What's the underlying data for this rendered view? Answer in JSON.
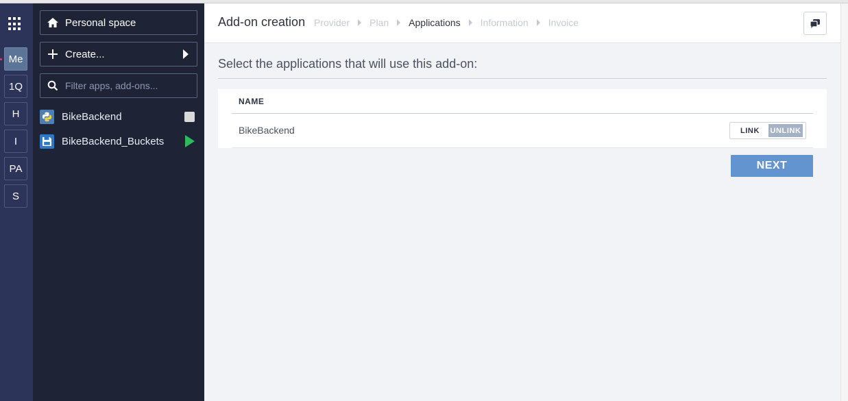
{
  "rail": {
    "orgs": [
      {
        "label": "Me",
        "active": true
      },
      {
        "label": "1Q",
        "active": false
      },
      {
        "label": "H",
        "active": false
      },
      {
        "label": "I",
        "active": false
      },
      {
        "label": "PA",
        "active": false
      },
      {
        "label": "S",
        "active": false
      }
    ]
  },
  "sidebar": {
    "personal_space_label": "Personal space",
    "create_label": "Create...",
    "filter_placeholder": "Filter apps, add-ons...",
    "apps": [
      {
        "name": "BikeBackend",
        "icon": "python-icon",
        "status": "stopped"
      },
      {
        "name": "BikeBackend_Buckets",
        "icon": "floppy-disk-icon",
        "status": "running"
      }
    ]
  },
  "header": {
    "title": "Add-on creation",
    "steps": [
      "Provider",
      "Plan",
      "Applications",
      "Information",
      "Invoice"
    ],
    "current_step": "Applications"
  },
  "main": {
    "subtitle": "Select the applications that will use this add-on:",
    "table": {
      "column_name": "NAME",
      "rows": [
        {
          "name": "BikeBackend",
          "link_label": "LINK",
          "unlink_label": "UNLINK",
          "selected": "UNLINK"
        }
      ]
    },
    "next_label": "NEXT"
  },
  "colors": {
    "rail_bg": "#2c3459",
    "sidebar_bg": "#1e2436",
    "accent": "#6394cf",
    "running": "#2ebb5c"
  }
}
